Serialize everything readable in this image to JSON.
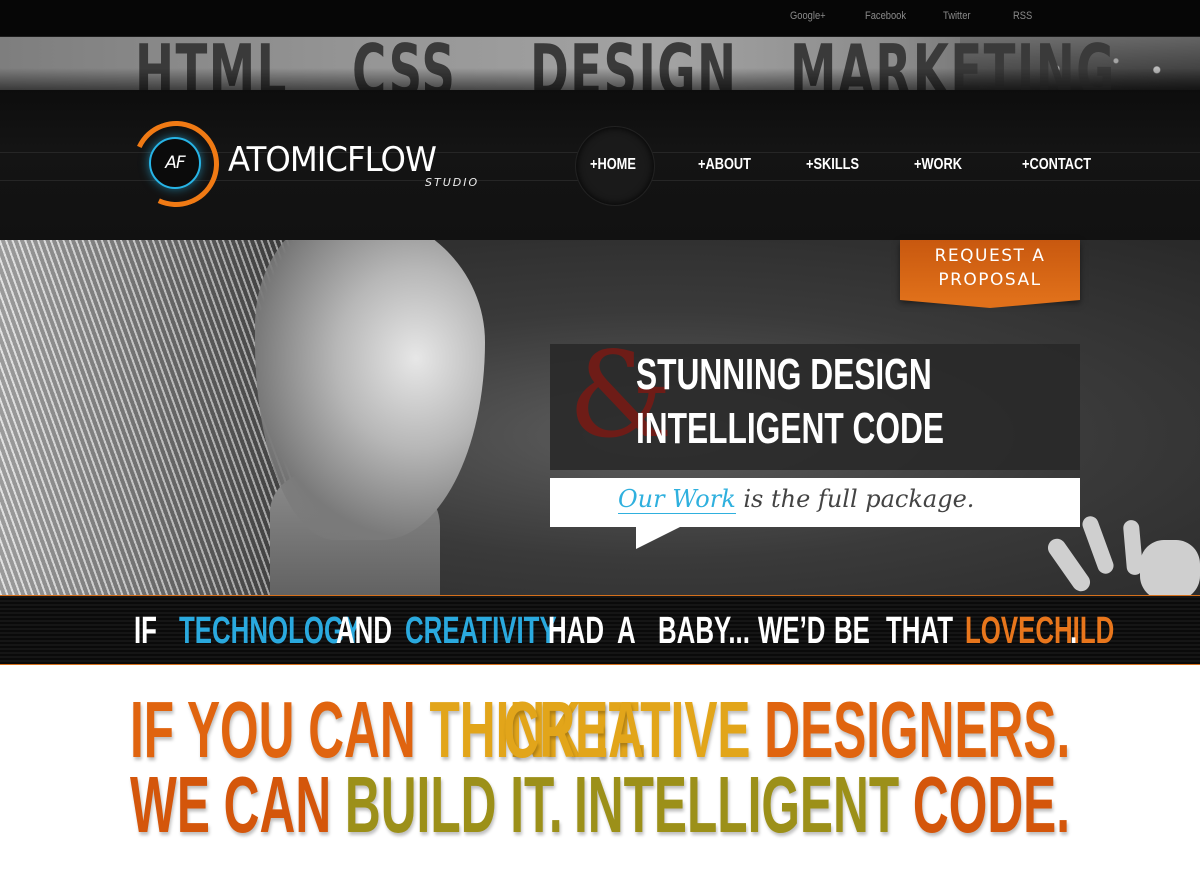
{
  "social_links": [
    {
      "label": "Google+"
    },
    {
      "label": "Facebook"
    },
    {
      "label": "Twitter"
    },
    {
      "label": "RSS"
    }
  ],
  "banner_words": [
    "HTML",
    "CSS",
    "DESIGN",
    "MARKETING"
  ],
  "logo": {
    "mark": "AF",
    "name": "ATOMICFLOW",
    "sub": "STUDIO"
  },
  "nav": [
    {
      "label": "+HOME",
      "active": true
    },
    {
      "label": "+ABOUT"
    },
    {
      "label": "+SKILLS"
    },
    {
      "label": "+WORK"
    },
    {
      "label": "+CONTACT"
    }
  ],
  "proposal_button": {
    "line1": "REQUEST A",
    "line2": "PROPOSAL"
  },
  "hero": {
    "ampersand": "&",
    "headline_1": "STUNNING DESIGN",
    "headline_2": "INTELLIGENT CODE",
    "bubble_link": "Our Work",
    "bubble_rest": " is the full package."
  },
  "lovechild": {
    "words": [
      {
        "text": "IF",
        "color": "#ffffff"
      },
      {
        "text": "TECHNOLOGY",
        "color": "#2aa9de"
      },
      {
        "text": "AND",
        "color": "#ffffff"
      },
      {
        "text": "CREATIVITY",
        "color": "#2aa9de"
      },
      {
        "text": "HAD",
        "color": "#ffffff"
      },
      {
        "text": "A",
        "color": "#ffffff"
      },
      {
        "text": "BABY...",
        "color": "#ffffff"
      },
      {
        "text": "WE’D",
        "color": "#ffffff"
      },
      {
        "text": "BE",
        "color": "#ffffff"
      },
      {
        "text": "THAT",
        "color": "#ffffff"
      },
      {
        "text": "LOVECHILD",
        "color": "#e8761c"
      },
      {
        "text": ".",
        "color": "#ffffff"
      }
    ]
  },
  "slogans": {
    "left_1a": "IF YOU CAN ",
    "left_1b": "THINK IT.",
    "left_2a": "WE CAN ",
    "left_2b": "BUILD IT.",
    "right_1a": "CREATIVE ",
    "right_1b": "DESIGNERS.",
    "right_2a": "INTELLIGENT ",
    "right_2b": "CODE."
  },
  "colors": {
    "accent_orange": "#e8761c",
    "accent_blue": "#2aa9de",
    "dark": "#0d0d0d"
  }
}
